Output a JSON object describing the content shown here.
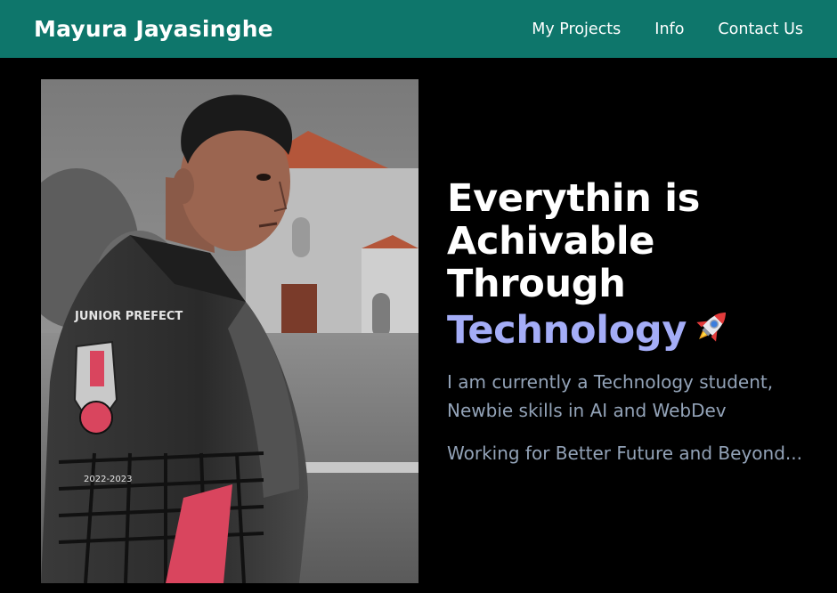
{
  "header": {
    "brand": "Mayura Jayasinghe",
    "nav": [
      {
        "label": "My Projects"
      },
      {
        "label": "Info"
      },
      {
        "label": "Contact Us"
      }
    ]
  },
  "hero": {
    "headline_lines": [
      "Everythin is",
      "Achivable",
      "Through"
    ],
    "headline_accent": "Technology",
    "rocket_icon": "rocket-icon",
    "description_1": "I am currently a Technology student, Newbie skills in AI and WebDev",
    "description_2": "Working for Better Future and Beyond...",
    "image_alt": "profile-photo",
    "shirt_text_1": "JUNIOR PREFECT",
    "shirt_text_2": "2022-2023"
  },
  "colors": {
    "navbar": "#0e766b",
    "background": "#000000",
    "accent": "#a4adf7",
    "body_text": "#93a3b8"
  }
}
